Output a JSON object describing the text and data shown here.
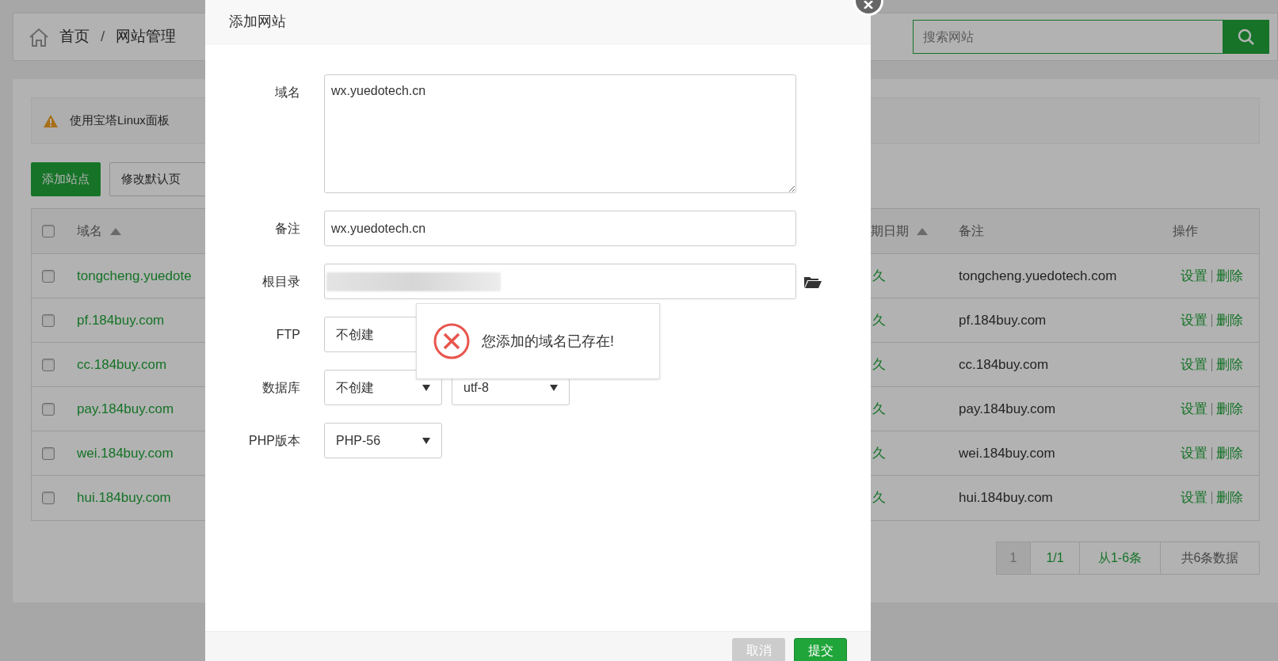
{
  "breadcrumb": {
    "items": [
      "首页",
      "网站管理"
    ],
    "separator": "/"
  },
  "search": {
    "placeholder": "搜索网站"
  },
  "notice": {
    "text": "使用宝塔Linux面板"
  },
  "toolbar": [
    "添加站点",
    "修改默认页"
  ],
  "table": {
    "header_checked": false,
    "columns": [
      {
        "label": "域名",
        "sortable": true
      },
      {
        "label": "期日期",
        "sortable": true
      },
      {
        "label": "备注",
        "sortable": false
      },
      {
        "label": "操作",
        "sortable": false
      }
    ],
    "rows": [
      {
        "checked": false,
        "domain": "tongcheng.yuedote",
        "expiry": "久",
        "note": "tongcheng.yuedotech.com",
        "actions": [
          "设置",
          "删除"
        ]
      },
      {
        "checked": false,
        "domain": "pf.184buy.com",
        "expiry": "久",
        "note": "pf.184buy.com",
        "actions": [
          "设置",
          "删除"
        ]
      },
      {
        "checked": false,
        "domain": "cc.184buy.com",
        "expiry": "久",
        "note": "cc.184buy.com",
        "actions": [
          "设置",
          "删除"
        ]
      },
      {
        "checked": false,
        "domain": "pay.184buy.com",
        "expiry": "久",
        "note": "pay.184buy.com",
        "actions": [
          "设置",
          "删除"
        ]
      },
      {
        "checked": false,
        "domain": "wei.184buy.com",
        "expiry": "久",
        "note": "wei.184buy.com",
        "actions": [
          "设置",
          "删除"
        ]
      },
      {
        "checked": false,
        "domain": "hui.184buy.com",
        "expiry": "久",
        "note": "hui.184buy.com",
        "actions": [
          "设置",
          "删除"
        ]
      }
    ]
  },
  "pagination": [
    {
      "label": "1",
      "selected": true
    },
    {
      "label": "1/1",
      "selected": false
    },
    {
      "label": "从1-6条",
      "selected": false
    },
    {
      "label": "共6条数据",
      "selected": false
    }
  ],
  "modal": {
    "title": "添加网站",
    "fields": [
      {
        "kind": "textarea",
        "label": "域名",
        "value": "wx.yuedotech.cn"
      },
      {
        "kind": "input",
        "label": "备注",
        "value": "wx.yuedotech.cn"
      },
      {
        "kind": "path",
        "label": "根目录"
      },
      {
        "kind": "covered_selects",
        "label": "FTP",
        "selects": [
          "不创建"
        ]
      },
      {
        "kind": "selects",
        "label": "数据库",
        "selects": [
          "不创建",
          "utf-8"
        ]
      },
      {
        "kind": "selects",
        "label": "PHP版本",
        "selects": [
          "PHP-56"
        ]
      }
    ],
    "buttons": [
      {
        "label": "取消",
        "kind": "cancel"
      },
      {
        "label": "提交",
        "kind": "primary"
      }
    ]
  },
  "toast": {
    "kind": "error",
    "message": "您添加的域名已存在!"
  }
}
